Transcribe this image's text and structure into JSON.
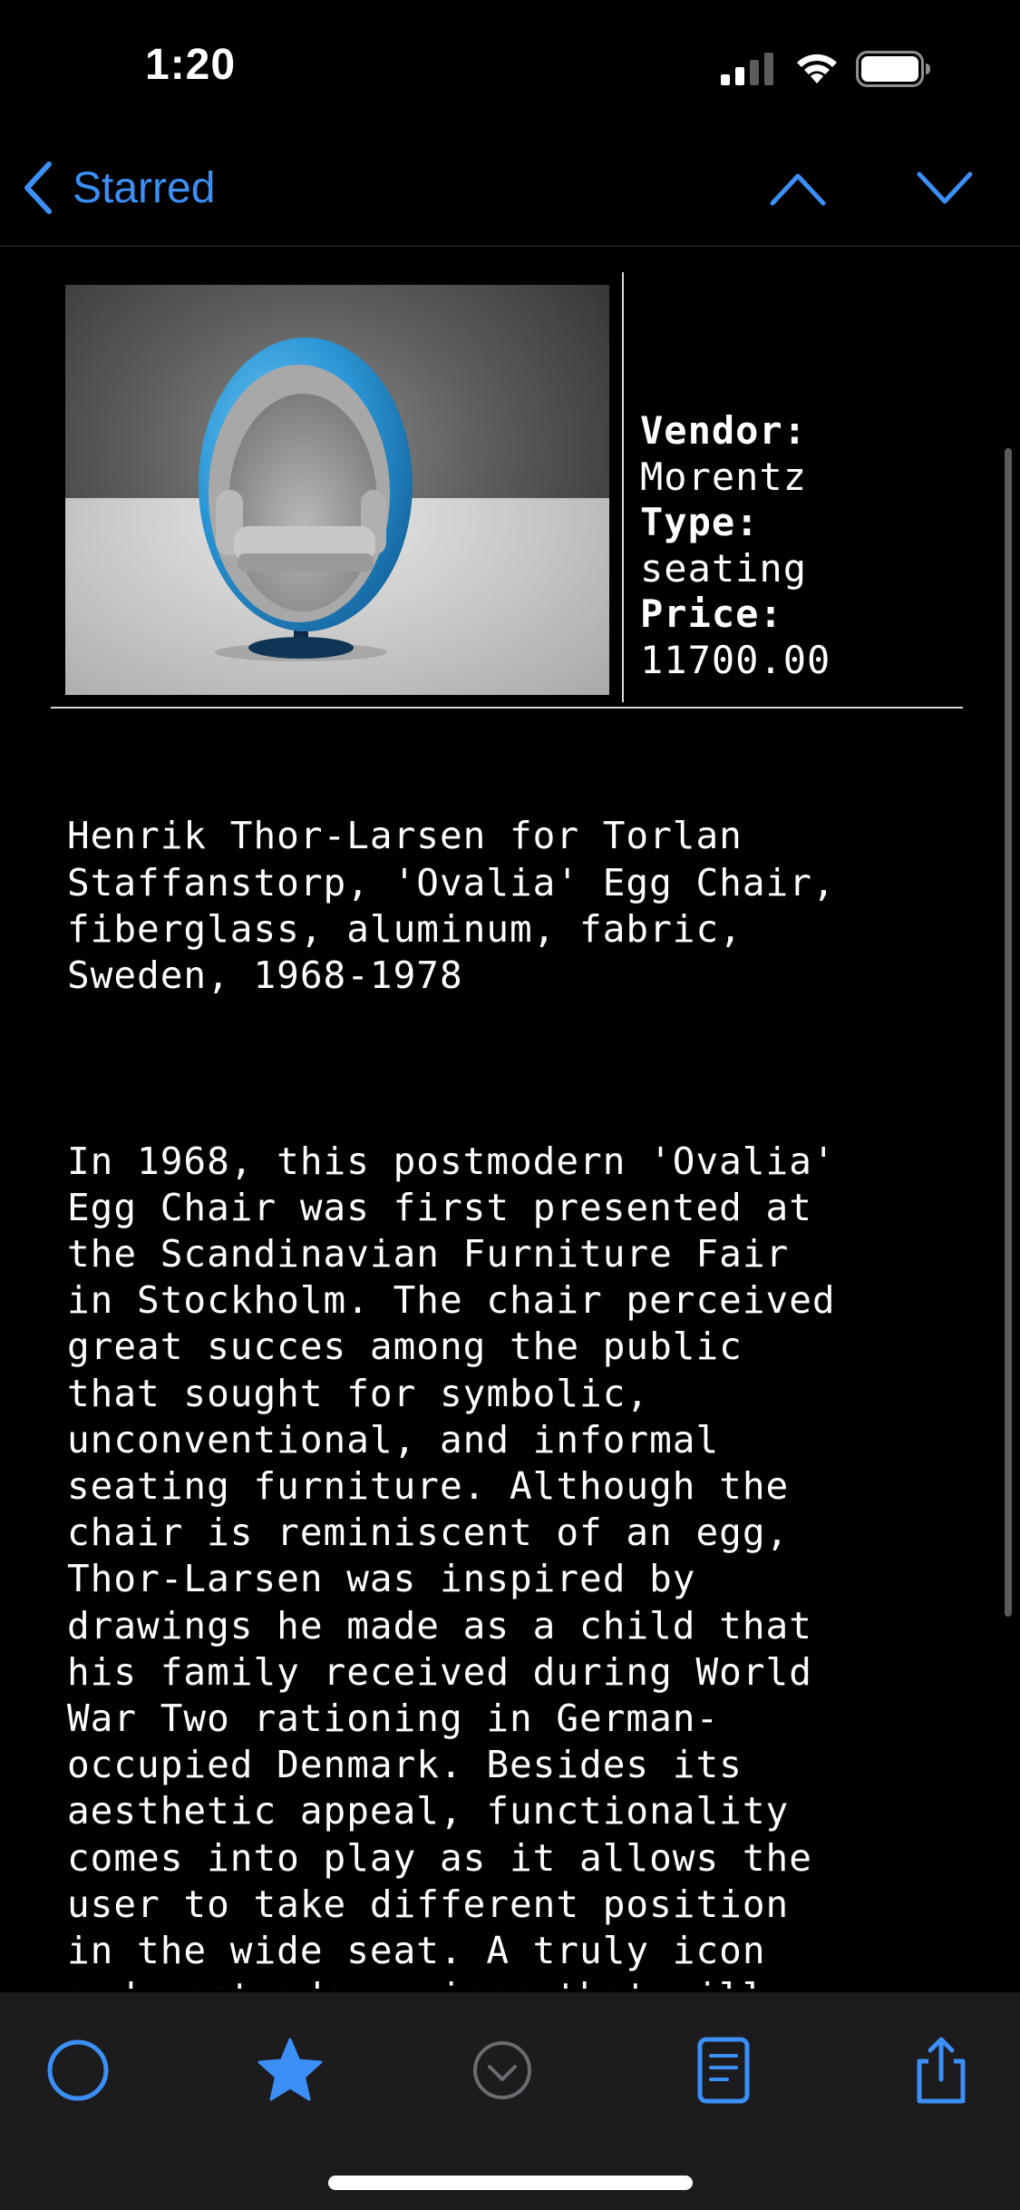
{
  "status_bar": {
    "time": "1:20"
  },
  "nav": {
    "back_label": "Starred"
  },
  "product": {
    "vendor_label": "Vendor:",
    "vendor": "Morentz",
    "type_label": "Type:",
    "type": "seating",
    "price_label": "Price:",
    "price": "11700.00",
    "title": "Henrik Thor-Larsen for Torlan\nStaffanstorp, 'Ovalia' Egg Chair,\nfiberglass, aluminum, fabric,\nSweden, 1968-1978",
    "description": "In 1968, this postmodern 'Ovalia'\nEgg Chair was first presented at\nthe Scandinavian Furniture Fair\nin Stockholm. The chair perceived\ngreat succes among the public\nthat sought for symbolic,\nunconventional, and informal\nseating furniture. Although the\nchair is reminiscent of an egg,\nThor-Larsen was inspired by\ndrawings he made as a child that\nhis family received during World\nWar Two rationing in German-\noccupied Denmark. Besides its\naesthetic appeal, functionality\ncomes into play as it allows the\nuser to take different position\nin the wide seat. A truly icon\nand postmodern piece that will\ngrab everyone's attention. This\nmodel was in production for ten\nyears from 1968-1978."
  },
  "toolbar": {
    "icons": [
      "circle-icon",
      "star-icon",
      "checkmark-circle-icon",
      "document-icon",
      "share-icon"
    ]
  },
  "colors": {
    "accent": "#3b8ff5",
    "background": "#000000",
    "toolbar_bg": "#1c1c1e",
    "disabled": "#6b6b70"
  }
}
